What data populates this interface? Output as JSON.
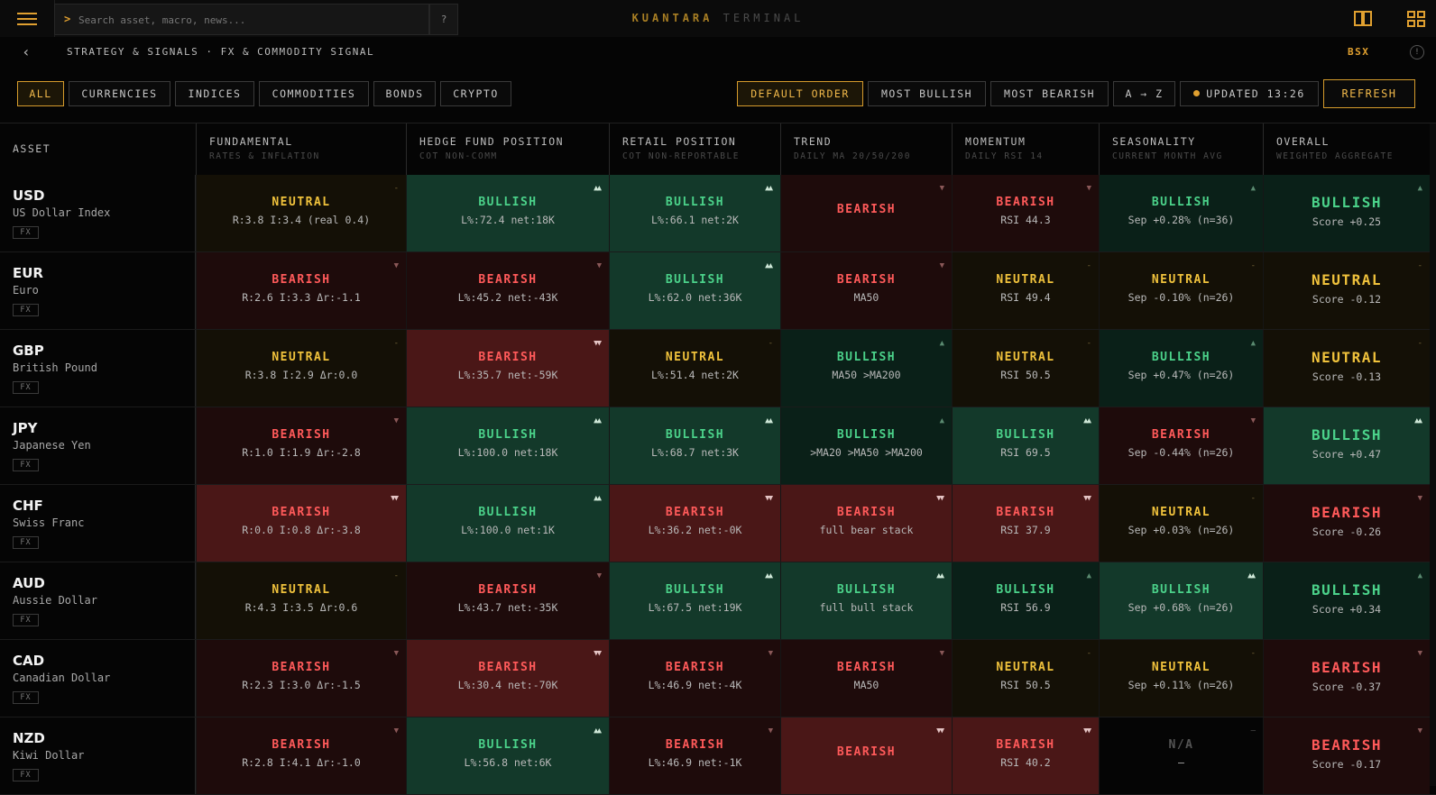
{
  "topbar": {
    "search_prompt": ">",
    "search_placeholder": "Search asset, macro, news...",
    "help_label": "?",
    "brand_primary": "KUANTARA",
    "brand_secondary": "TERMINAL",
    "icons": [
      "menu-icon",
      "book-icon",
      "grid-icon"
    ]
  },
  "breadcrumb": {
    "back_icon": "‹",
    "path": "STRATEGY & SIGNALS · FX & COMMODITY SIGNAL",
    "exchange": "BSX",
    "info_icon": "!"
  },
  "filters": {
    "categories": [
      {
        "label": "ALL",
        "active": true
      },
      {
        "label": "CURRENCIES",
        "active": false
      },
      {
        "label": "INDICES",
        "active": false
      },
      {
        "label": "COMMODITIES",
        "active": false
      },
      {
        "label": "BONDS",
        "active": false
      },
      {
        "label": "CRYPTO",
        "active": false
      }
    ],
    "sorts": [
      {
        "label": "DEFAULT ORDER",
        "active": true
      },
      {
        "label": "MOST BULLISH",
        "active": false
      },
      {
        "label": "MOST BEARISH",
        "active": false
      },
      {
        "label": "A → Z",
        "active": false
      }
    ],
    "updated": "UPDATED 13:26",
    "refresh": "REFRESH"
  },
  "colors": {
    "accent": "#e0a030",
    "bullish": "#4bd28a",
    "bearish": "#ff5a5a",
    "neutral": "#f0c23c"
  },
  "table": {
    "asset_header": "ASSET",
    "columns": [
      {
        "title": "FUNDAMENTAL",
        "sub": "RATES & INFLATION"
      },
      {
        "title": "HEDGE FUND POSITION",
        "sub": "COT NON-COMM"
      },
      {
        "title": "RETAIL POSITION",
        "sub": "COT NON-REPORTABLE"
      },
      {
        "title": "TREND",
        "sub": "DAILY MA 20/50/200"
      },
      {
        "title": "MOMENTUM",
        "sub": "DAILY RSI 14"
      },
      {
        "title": "SEASONALITY",
        "sub": "CURRENT MONTH AVG"
      },
      {
        "title": "OVERALL",
        "sub": "WEIGHTED AGGREGATE"
      }
    ],
    "rows": [
      {
        "symbol": "USD",
        "name": "US Dollar Index",
        "tag": "FX",
        "cells": [
          {
            "label": "NEUTRAL",
            "detail": "R:3.8 I:3.4 (real 0.4)",
            "sentiment": "neut",
            "strength": 1
          },
          {
            "label": "BULLISH",
            "detail": "L%:72.4 net:18K",
            "sentiment": "bull",
            "strength": 2
          },
          {
            "label": "BULLISH",
            "detail": "L%:66.1 net:2K",
            "sentiment": "bull",
            "strength": 2
          },
          {
            "label": "BEARISH",
            "detail": "",
            "sentiment": "bear",
            "strength": 1
          },
          {
            "label": "BEARISH",
            "detail": "RSI 44.3",
            "sentiment": "bear",
            "strength": 1
          },
          {
            "label": "BULLISH",
            "detail": "Sep +0.28% (n=36)",
            "sentiment": "bull",
            "strength": 1
          },
          {
            "label": "BULLISH",
            "detail": "Score +0.25",
            "sentiment": "bull",
            "strength": 1
          }
        ]
      },
      {
        "symbol": "EUR",
        "name": "Euro",
        "tag": "FX",
        "cells": [
          {
            "label": "BEARISH",
            "detail": "R:2.6 I:3.3 Δr:-1.1",
            "sentiment": "bear",
            "strength": 1
          },
          {
            "label": "BEARISH",
            "detail": "L%:45.2 net:-43K",
            "sentiment": "bear",
            "strength": 1
          },
          {
            "label": "BULLISH",
            "detail": "L%:62.0 net:36K",
            "sentiment": "bull",
            "strength": 2
          },
          {
            "label": "BEARISH",
            "detail": "MA50",
            "sentiment": "bear",
            "strength": 1
          },
          {
            "label": "NEUTRAL",
            "detail": "RSI 49.4",
            "sentiment": "neut",
            "strength": 1
          },
          {
            "label": "NEUTRAL",
            "detail": "Sep -0.10% (n=26)",
            "sentiment": "neut",
            "strength": 1
          },
          {
            "label": "NEUTRAL",
            "detail": "Score -0.12",
            "sentiment": "neut",
            "strength": 1
          }
        ]
      },
      {
        "symbol": "GBP",
        "name": "British Pound",
        "tag": "FX",
        "cells": [
          {
            "label": "NEUTRAL",
            "detail": "R:3.8 I:2.9 Δr:0.0",
            "sentiment": "neut",
            "strength": 1
          },
          {
            "label": "BEARISH",
            "detail": "L%:35.7 net:-59K",
            "sentiment": "bear",
            "strength": 2
          },
          {
            "label": "NEUTRAL",
            "detail": "L%:51.4 net:2K",
            "sentiment": "neut",
            "strength": 1
          },
          {
            "label": "BULLISH",
            "detail": "MA50 >MA200",
            "sentiment": "bull",
            "strength": 1
          },
          {
            "label": "NEUTRAL",
            "detail": "RSI 50.5",
            "sentiment": "neut",
            "strength": 1
          },
          {
            "label": "BULLISH",
            "detail": "Sep +0.47% (n=26)",
            "sentiment": "bull",
            "strength": 1
          },
          {
            "label": "NEUTRAL",
            "detail": "Score -0.13",
            "sentiment": "neut",
            "strength": 1
          }
        ]
      },
      {
        "symbol": "JPY",
        "name": "Japanese Yen",
        "tag": "FX",
        "cells": [
          {
            "label": "BEARISH",
            "detail": "R:1.0 I:1.9 Δr:-2.8",
            "sentiment": "bear",
            "strength": 1
          },
          {
            "label": "BULLISH",
            "detail": "L%:100.0 net:18K",
            "sentiment": "bull",
            "strength": 2
          },
          {
            "label": "BULLISH",
            "detail": "L%:68.7 net:3K",
            "sentiment": "bull",
            "strength": 2
          },
          {
            "label": "BULLISH",
            "detail": ">MA20 >MA50 >MA200",
            "sentiment": "bull",
            "strength": 1
          },
          {
            "label": "BULLISH",
            "detail": "RSI 69.5",
            "sentiment": "bull",
            "strength": 2
          },
          {
            "label": "BEARISH",
            "detail": "Sep -0.44% (n=26)",
            "sentiment": "bear",
            "strength": 1
          },
          {
            "label": "BULLISH",
            "detail": "Score +0.47",
            "sentiment": "bull",
            "strength": 2
          }
        ]
      },
      {
        "symbol": "CHF",
        "name": "Swiss Franc",
        "tag": "FX",
        "cells": [
          {
            "label": "BEARISH",
            "detail": "R:0.0 I:0.8 Δr:-3.8",
            "sentiment": "bear",
            "strength": 2
          },
          {
            "label": "BULLISH",
            "detail": "L%:100.0 net:1K",
            "sentiment": "bull",
            "strength": 2
          },
          {
            "label": "BEARISH",
            "detail": "L%:36.2 net:-0K",
            "sentiment": "bear",
            "strength": 2
          },
          {
            "label": "BEARISH",
            "detail": "full bear stack",
            "sentiment": "bear",
            "strength": 2
          },
          {
            "label": "BEARISH",
            "detail": "RSI 37.9",
            "sentiment": "bear",
            "strength": 2
          },
          {
            "label": "NEUTRAL",
            "detail": "Sep +0.03% (n=26)",
            "sentiment": "neut",
            "strength": 1
          },
          {
            "label": "BEARISH",
            "detail": "Score -0.26",
            "sentiment": "bear",
            "strength": 1
          }
        ]
      },
      {
        "symbol": "AUD",
        "name": "Aussie Dollar",
        "tag": "FX",
        "cells": [
          {
            "label": "NEUTRAL",
            "detail": "R:4.3 I:3.5 Δr:0.6",
            "sentiment": "neut",
            "strength": 1
          },
          {
            "label": "BEARISH",
            "detail": "L%:43.7 net:-35K",
            "sentiment": "bear",
            "strength": 1
          },
          {
            "label": "BULLISH",
            "detail": "L%:67.5 net:19K",
            "sentiment": "bull",
            "strength": 2
          },
          {
            "label": "BULLISH",
            "detail": "full bull stack",
            "sentiment": "bull",
            "strength": 2
          },
          {
            "label": "BULLISH",
            "detail": "RSI 56.9",
            "sentiment": "bull",
            "strength": 1
          },
          {
            "label": "BULLISH",
            "detail": "Sep +0.68% (n=26)",
            "sentiment": "bull",
            "strength": 2
          },
          {
            "label": "BULLISH",
            "detail": "Score +0.34",
            "sentiment": "bull",
            "strength": 1
          }
        ]
      },
      {
        "symbol": "CAD",
        "name": "Canadian Dollar",
        "tag": "FX",
        "cells": [
          {
            "label": "BEARISH",
            "detail": "R:2.3 I:3.0 Δr:-1.5",
            "sentiment": "bear",
            "strength": 1
          },
          {
            "label": "BEARISH",
            "detail": "L%:30.4 net:-70K",
            "sentiment": "bear",
            "strength": 2
          },
          {
            "label": "BEARISH",
            "detail": "L%:46.9 net:-4K",
            "sentiment": "bear",
            "strength": 1
          },
          {
            "label": "BEARISH",
            "detail": "MA50",
            "sentiment": "bear",
            "strength": 1
          },
          {
            "label": "NEUTRAL",
            "detail": "RSI 50.5",
            "sentiment": "neut",
            "strength": 1
          },
          {
            "label": "NEUTRAL",
            "detail": "Sep +0.11% (n=26)",
            "sentiment": "neut",
            "strength": 1
          },
          {
            "label": "BEARISH",
            "detail": "Score -0.37",
            "sentiment": "bear",
            "strength": 1
          }
        ]
      },
      {
        "symbol": "NZD",
        "name": "Kiwi Dollar",
        "tag": "FX",
        "cells": [
          {
            "label": "BEARISH",
            "detail": "R:2.8 I:4.1 Δr:-1.0",
            "sentiment": "bear",
            "strength": 1
          },
          {
            "label": "BULLISH",
            "detail": "L%:56.8 net:6K",
            "sentiment": "bull",
            "strength": 2
          },
          {
            "label": "BEARISH",
            "detail": "L%:46.9 net:-1K",
            "sentiment": "bear",
            "strength": 1
          },
          {
            "label": "BEARISH",
            "detail": "",
            "sentiment": "bear",
            "strength": 2
          },
          {
            "label": "BEARISH",
            "detail": "RSI 40.2",
            "sentiment": "bear",
            "strength": 2
          },
          {
            "label": "N/A",
            "detail": "—",
            "sentiment": "na",
            "strength": 0
          },
          {
            "label": "BEARISH",
            "detail": "Score -0.17",
            "sentiment": "bear",
            "strength": 1
          }
        ]
      }
    ]
  }
}
